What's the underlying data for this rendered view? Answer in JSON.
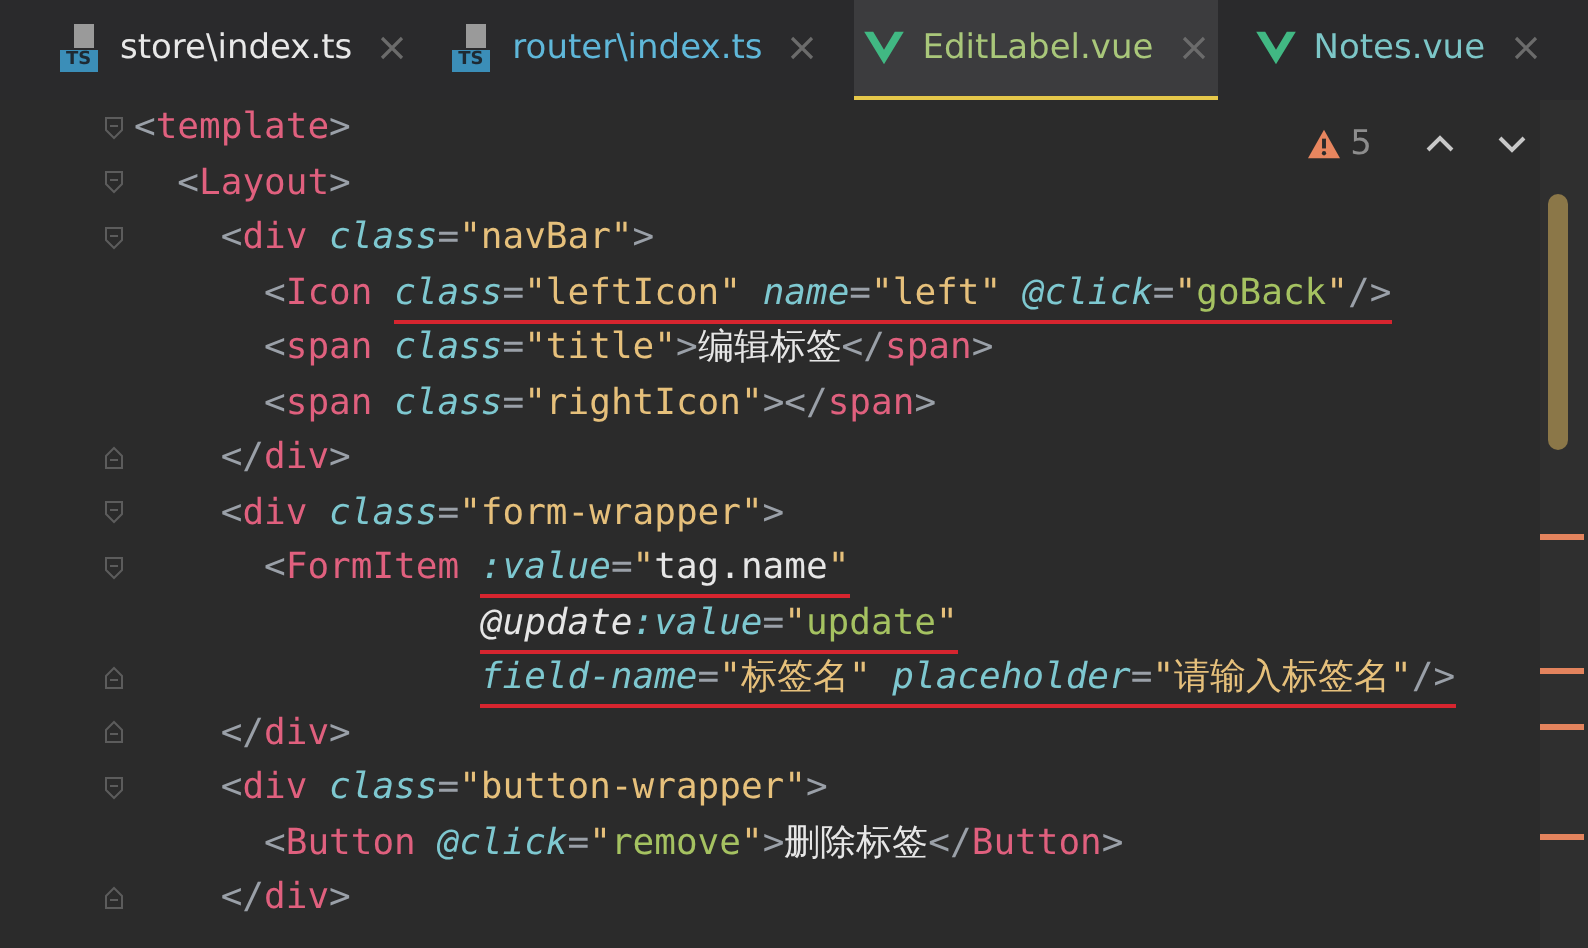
{
  "tabs": [
    {
      "label": "store\\index.ts",
      "kind": "ts",
      "icon_text": "TS",
      "selected": false
    },
    {
      "label": "router\\index.ts",
      "kind": "ts",
      "icon_text": "TS",
      "selected": false
    },
    {
      "label": "EditLabel.vue",
      "kind": "vue",
      "selected": true
    },
    {
      "label": "Notes.vue",
      "kind": "vue",
      "selected": false
    }
  ],
  "inspection": {
    "count": "5"
  },
  "code_lines": [
    {
      "kind": "open",
      "words": [
        [
          {
            "kind": "punct",
            "text": "<"
          },
          {
            "kind": "tag",
            "text": "template"
          },
          {
            "kind": "punct",
            "text": ">"
          }
        ]
      ],
      "children": [
        {
          "kind": "open",
          "words": [
            [
              {
                "kind": "punct",
                "text": "<"
              },
              {
                "kind": "tag",
                "text": "Layout"
              },
              {
                "kind": "punct",
                "text": ">"
              }
            ]
          ],
          "children": [
            {
              "kind": "open",
              "words": [
                [
                  {
                    "kind": "punct",
                    "text": "<"
                  },
                  {
                    "kind": "tag",
                    "text": "div"
                  }
                ],
                [
                  {
                    "kind": "attr",
                    "text": "class"
                  },
                  {
                    "kind": "punct",
                    "text": "="
                  },
                  {
                    "kind": "string",
                    "text": "\"navBar\""
                  },
                  {
                    "kind": "punct",
                    "text": ">"
                  }
                ]
              ],
              "children": [
                {
                  "kind": "plain",
                  "words": [
                    [
                      {
                        "kind": "punct",
                        "text": "<"
                      },
                      {
                        "kind": "tag",
                        "text": "Icon"
                      }
                    ]
                  ],
                  "underlined": [
                    [
                      {
                        "kind": "attr",
                        "text": "class"
                      },
                      {
                        "kind": "punct",
                        "text": "="
                      },
                      {
                        "kind": "string",
                        "text": "\"leftIcon\""
                      }
                    ],
                    [
                      {
                        "kind": "attr",
                        "text": "name"
                      },
                      {
                        "kind": "punct",
                        "text": "="
                      },
                      {
                        "kind": "string",
                        "text": "\"left\""
                      }
                    ],
                    [
                      {
                        "kind": "attr",
                        "text": "@click"
                      },
                      {
                        "kind": "punct",
                        "text": "="
                      },
                      {
                        "kind": "string",
                        "text": "\""
                      },
                      {
                        "kind": "handler",
                        "text": "goBack"
                      },
                      {
                        "kind": "string",
                        "text": "\""
                      },
                      {
                        "kind": "punct",
                        "text": "/>"
                      }
                    ]
                  ]
                },
                {
                  "kind": "plain",
                  "words": [
                    [
                      {
                        "kind": "punct",
                        "text": "<"
                      },
                      {
                        "kind": "tag",
                        "text": "span"
                      }
                    ],
                    [
                      {
                        "kind": "attr",
                        "text": "class"
                      },
                      {
                        "kind": "punct",
                        "text": "="
                      },
                      {
                        "kind": "string",
                        "text": "\"title\""
                      },
                      {
                        "kind": "punct",
                        "text": ">"
                      },
                      {
                        "kind": "plain",
                        "text": "编辑标签"
                      },
                      {
                        "kind": "punct",
                        "text": "</"
                      },
                      {
                        "kind": "tag",
                        "text": "span"
                      },
                      {
                        "kind": "punct",
                        "text": ">"
                      }
                    ]
                  ]
                },
                {
                  "kind": "plain",
                  "words": [
                    [
                      {
                        "kind": "punct",
                        "text": "<"
                      },
                      {
                        "kind": "tag",
                        "text": "span"
                      }
                    ],
                    [
                      {
                        "kind": "attr",
                        "text": "class"
                      },
                      {
                        "kind": "punct",
                        "text": "="
                      },
                      {
                        "kind": "string",
                        "text": "\"rightIcon\""
                      },
                      {
                        "kind": "punct",
                        "text": "></"
                      },
                      {
                        "kind": "tag",
                        "text": "span"
                      },
                      {
                        "kind": "punct",
                        "text": ">"
                      }
                    ]
                  ]
                }
              ]
            },
            {
              "kind": "close",
              "words": [
                [
                  {
                    "kind": "punct",
                    "text": "</"
                  },
                  {
                    "kind": "tag",
                    "text": "div"
                  },
                  {
                    "kind": "punct",
                    "text": ">"
                  }
                ]
              ]
            },
            {
              "kind": "open",
              "words": [
                [
                  {
                    "kind": "punct",
                    "text": "<"
                  },
                  {
                    "kind": "tag",
                    "text": "div"
                  }
                ],
                [
                  {
                    "kind": "attr",
                    "text": "class"
                  },
                  {
                    "kind": "punct",
                    "text": "="
                  },
                  {
                    "kind": "string",
                    "text": "\"form-wrapper\""
                  },
                  {
                    "kind": "punct",
                    "text": ">"
                  }
                ]
              ],
              "children": [
                {
                  "kind": "open",
                  "words": [
                    [
                      {
                        "kind": "punct",
                        "text": "<"
                      },
                      {
                        "kind": "tag",
                        "text": "FormItem"
                      }
                    ]
                  ],
                  "underlined": [
                    [
                      {
                        "kind": "attr",
                        "text": ":value"
                      },
                      {
                        "kind": "punct",
                        "text": "="
                      },
                      {
                        "kind": "string",
                        "text": "\""
                      },
                      {
                        "kind": "plain",
                        "text": "tag.name"
                      },
                      {
                        "kind": "string",
                        "text": "\""
                      }
                    ]
                  ],
                  "children": [
                    {
                      "kind": "continuation",
                      "underlined": [
                        [
                          {
                            "kind": "event",
                            "text": "@update"
                          },
                          {
                            "kind": "attr",
                            "text": ":value"
                          },
                          {
                            "kind": "punct",
                            "text": "="
                          },
                          {
                            "kind": "string",
                            "text": "\""
                          },
                          {
                            "kind": "handler",
                            "text": "update"
                          },
                          {
                            "kind": "string",
                            "text": "\""
                          }
                        ]
                      ]
                    },
                    {
                      "kind": "tail",
                      "underlined": [
                        [
                          {
                            "kind": "attr",
                            "text": "field-name"
                          },
                          {
                            "kind": "punct",
                            "text": "="
                          },
                          {
                            "kind": "string",
                            "text": "\"标签名\""
                          }
                        ],
                        [
                          {
                            "kind": "attr",
                            "text": "placeholder"
                          },
                          {
                            "kind": "punct",
                            "text": "="
                          },
                          {
                            "kind": "string",
                            "text": "\"请输入标签名\""
                          },
                          {
                            "kind": "punct",
                            "text": "/>"
                          }
                        ]
                      ]
                    }
                  ]
                }
              ]
            },
            {
              "kind": "close",
              "words": [
                [
                  {
                    "kind": "punct",
                    "text": "</"
                  },
                  {
                    "kind": "tag",
                    "text": "div"
                  },
                  {
                    "kind": "punct",
                    "text": ">"
                  }
                ]
              ]
            },
            {
              "kind": "open",
              "words": [
                [
                  {
                    "kind": "punct",
                    "text": "<"
                  },
                  {
                    "kind": "tag",
                    "text": "div"
                  }
                ],
                [
                  {
                    "kind": "attr",
                    "text": "class"
                  },
                  {
                    "kind": "punct",
                    "text": "="
                  },
                  {
                    "kind": "string",
                    "text": "\"button-wrapper\""
                  },
                  {
                    "kind": "punct",
                    "text": ">"
                  }
                ]
              ],
              "children": [
                {
                  "kind": "plain",
                  "words": [
                    [
                      {
                        "kind": "punct",
                        "text": "<"
                      },
                      {
                        "kind": "tag",
                        "text": "Button"
                      }
                    ],
                    [
                      {
                        "kind": "attr",
                        "text": "@click"
                      },
                      {
                        "kind": "punct",
                        "text": "="
                      },
                      {
                        "kind": "string",
                        "text": "\""
                      },
                      {
                        "kind": "handler",
                        "text": "remove"
                      },
                      {
                        "kind": "string",
                        "text": "\""
                      },
                      {
                        "kind": "punct",
                        "text": ">"
                      },
                      {
                        "kind": "plain",
                        "text": "删除标签"
                      },
                      {
                        "kind": "punct",
                        "text": "</"
                      },
                      {
                        "kind": "tag",
                        "text": "Button"
                      },
                      {
                        "kind": "punct",
                        "text": ">"
                      }
                    ]
                  ]
                }
              ]
            },
            {
              "kind": "close",
              "words": [
                [
                  {
                    "kind": "punct",
                    "text": "</"
                  },
                  {
                    "kind": "tag",
                    "text": "div"
                  },
                  {
                    "kind": "punct",
                    "text": ">"
                  }
                ]
              ]
            }
          ]
        }
      ]
    }
  ]
}
